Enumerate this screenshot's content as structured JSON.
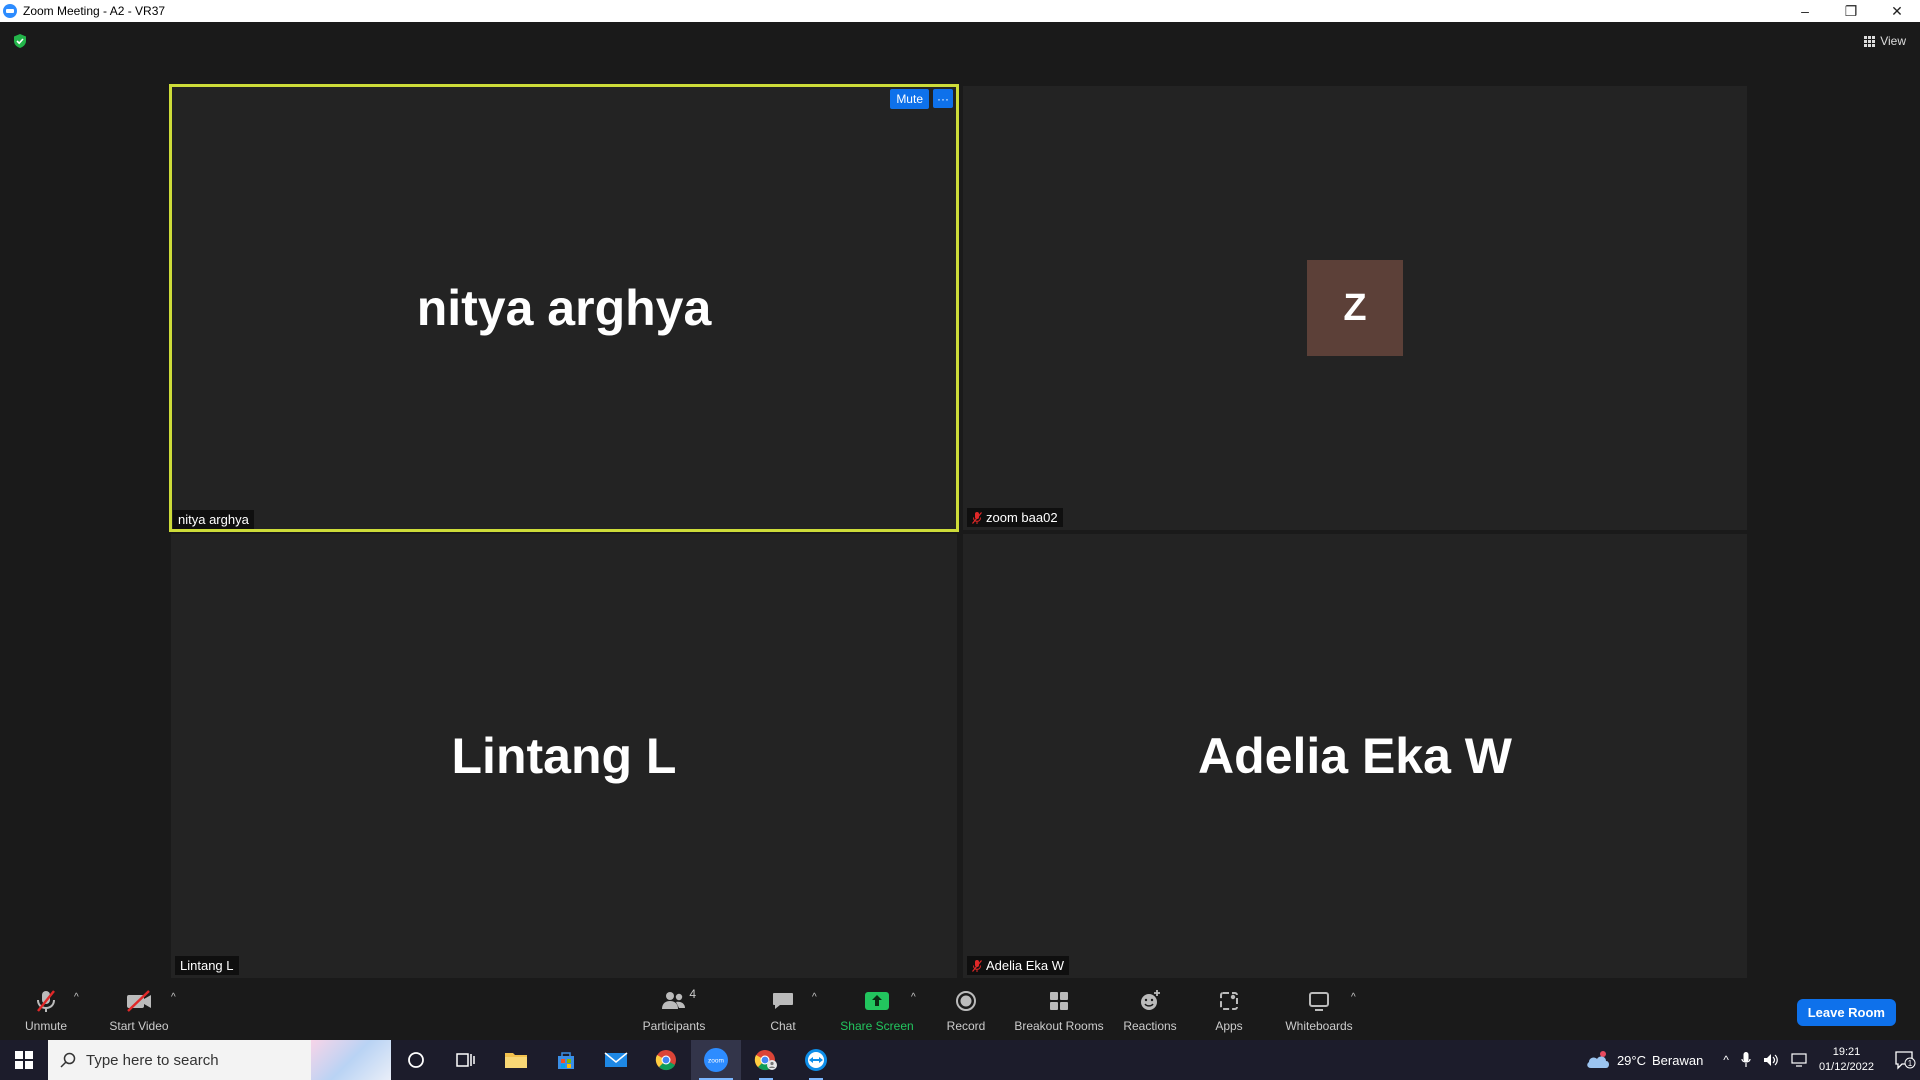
{
  "window": {
    "title": "Zoom Meeting - A2 - VR37",
    "minimize": "–",
    "restore": "❐",
    "close": "✕"
  },
  "top": {
    "view_label": "View"
  },
  "tiles": [
    {
      "display_name": "nitya arghya",
      "name_tag": "nitya arghya",
      "mute_label": "Mute",
      "more_label": "···",
      "active": true
    },
    {
      "avatar_letter": "Z",
      "name_tag": "zoom baa02",
      "muted": true
    },
    {
      "display_name": "Lintang L",
      "name_tag": "Lintang L"
    },
    {
      "display_name": "Adelia Eka W",
      "name_tag": "Adelia Eka W",
      "muted": true
    }
  ],
  "controls": {
    "unmute": "Unmute",
    "start_video": "Start Video",
    "participants": "Participants",
    "participants_count": "4",
    "chat": "Chat",
    "share_screen": "Share Screen",
    "record": "Record",
    "breakout_rooms": "Breakout Rooms",
    "reactions": "Reactions",
    "apps": "Apps",
    "whiteboards": "Whiteboards",
    "leave": "Leave Room"
  },
  "taskbar": {
    "search_placeholder": "Type here to search",
    "zoom_icon_text": "zoom",
    "weather_temp": "29°C",
    "weather_desc": "Berawan",
    "time": "19:21",
    "date": "01/12/2022",
    "notif_count": "1"
  },
  "colors": {
    "accent": "#0e71eb",
    "active_border": "#cddc39",
    "avatar_bg": "#5c4038",
    "share_green": "#22c55e",
    "muted_red": "#e02828"
  }
}
